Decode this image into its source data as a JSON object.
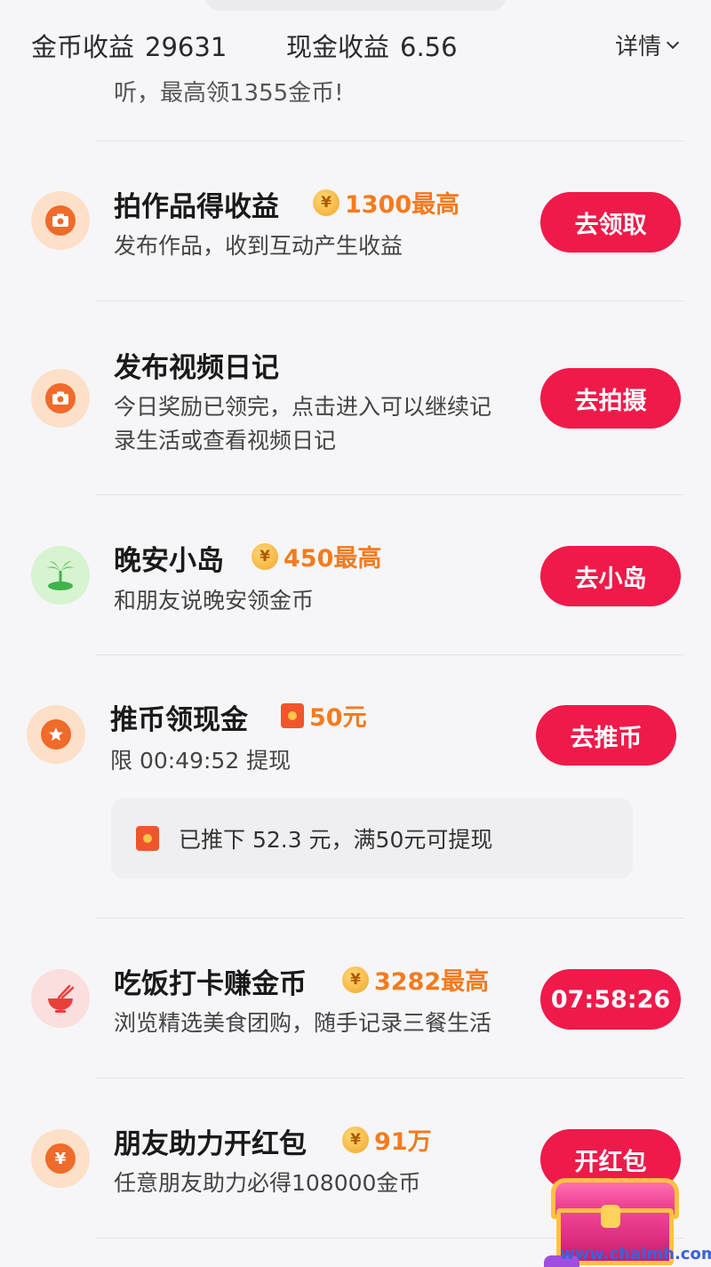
{
  "header": {
    "coin_earnings_label": "金币收益",
    "coin_earnings_value": "29631",
    "cash_earnings_label": "现金收益",
    "cash_earnings_value": "6.56",
    "details_label": "详情"
  },
  "partial_task": {
    "desc": "听，最高领1355金币!"
  },
  "tasks": [
    {
      "title": "拍作品得收益",
      "reward": "1300最高",
      "desc": "发布作品，收到互动产生收益",
      "button": "去领取",
      "icon": "camera-icon"
    },
    {
      "title": "发布视频日记",
      "desc_line1": "今日奖励已领完，点击进入可以继续记",
      "desc_line2": "录生活或查看视频日记",
      "button": "去拍摄",
      "icon": "camera-icon"
    },
    {
      "title": "晚安小岛",
      "reward": "450最高",
      "desc": "和朋友说晚安领金币",
      "button": "去小岛",
      "icon": "island-icon"
    },
    {
      "title": "推币领现金",
      "reward": "50元",
      "desc": "限 00:49:52 提现",
      "button": "去推币",
      "icon": "coin-pusher-icon",
      "info": "已推下 52.3 元，满50元可提现"
    },
    {
      "title": "吃饭打卡赚金币",
      "reward": "3282最高",
      "desc": "浏览精选美食团购，随手记录三餐生活",
      "button": "07:58:26",
      "icon": "rice-bowl-icon"
    },
    {
      "title": "朋友助力开红包",
      "reward": "91万",
      "desc": "任意朋友助力必得108000金币",
      "button": "开红包",
      "icon": "yuan-icon"
    }
  ],
  "coin_symbol": "¥",
  "watermark": "www.chalmh.com",
  "colors": {
    "accent_button": "#ef1a4a",
    "reward_text": "#f47b1e",
    "icon_orange": "#f06a2a"
  }
}
